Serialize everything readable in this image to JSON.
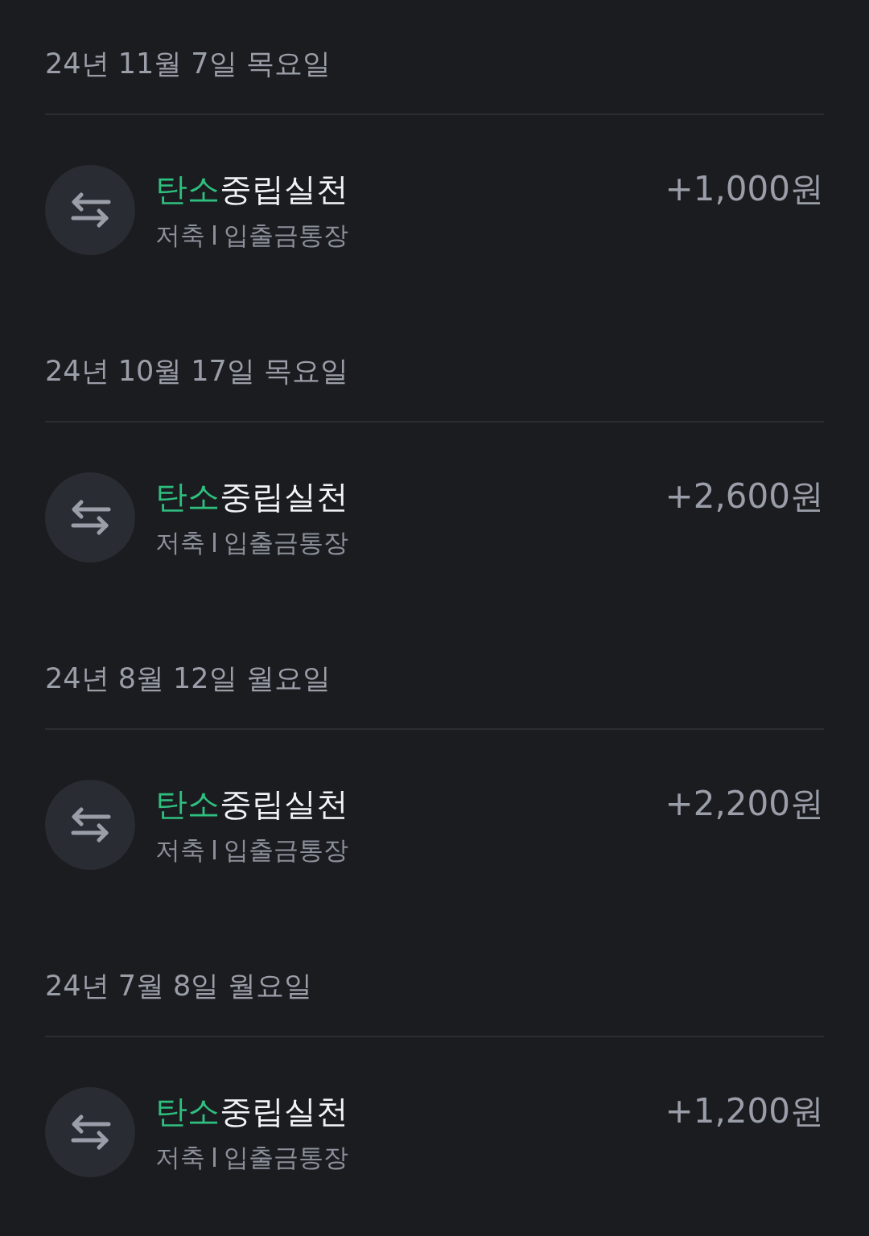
{
  "sections": [
    {
      "date": "24년 11월 7일 목요일",
      "transactions": [
        {
          "title_parts": [
            {
              "text": "탄소",
              "highlight": true
            },
            {
              "text": "중립실천",
              "highlight": false
            }
          ],
          "category": "저축",
          "account": "입출금통장",
          "amount": "+1,000원"
        }
      ]
    },
    {
      "date": "24년 10월 17일 목요일",
      "transactions": [
        {
          "title_parts": [
            {
              "text": "탄소",
              "highlight": true
            },
            {
              "text": "중립실천",
              "highlight": false
            }
          ],
          "category": "저축",
          "account": "입출금통장",
          "amount": "+2,600원"
        }
      ]
    },
    {
      "date": "24년 8월 12일 월요일",
      "transactions": [
        {
          "title_parts": [
            {
              "text": "탄소",
              "highlight": true
            },
            {
              "text": "중립실천",
              "highlight": false
            }
          ],
          "category": "저축",
          "account": "입출금통장",
          "amount": "+2,200원"
        }
      ]
    },
    {
      "date": "24년 7월 8일 월요일",
      "transactions": [
        {
          "title_parts": [
            {
              "text": "탄소",
              "highlight": true
            },
            {
              "text": "중립실천",
              "highlight": false
            }
          ],
          "category": "저축",
          "account": "입출금통장",
          "amount": "+1,200원"
        }
      ]
    }
  ]
}
